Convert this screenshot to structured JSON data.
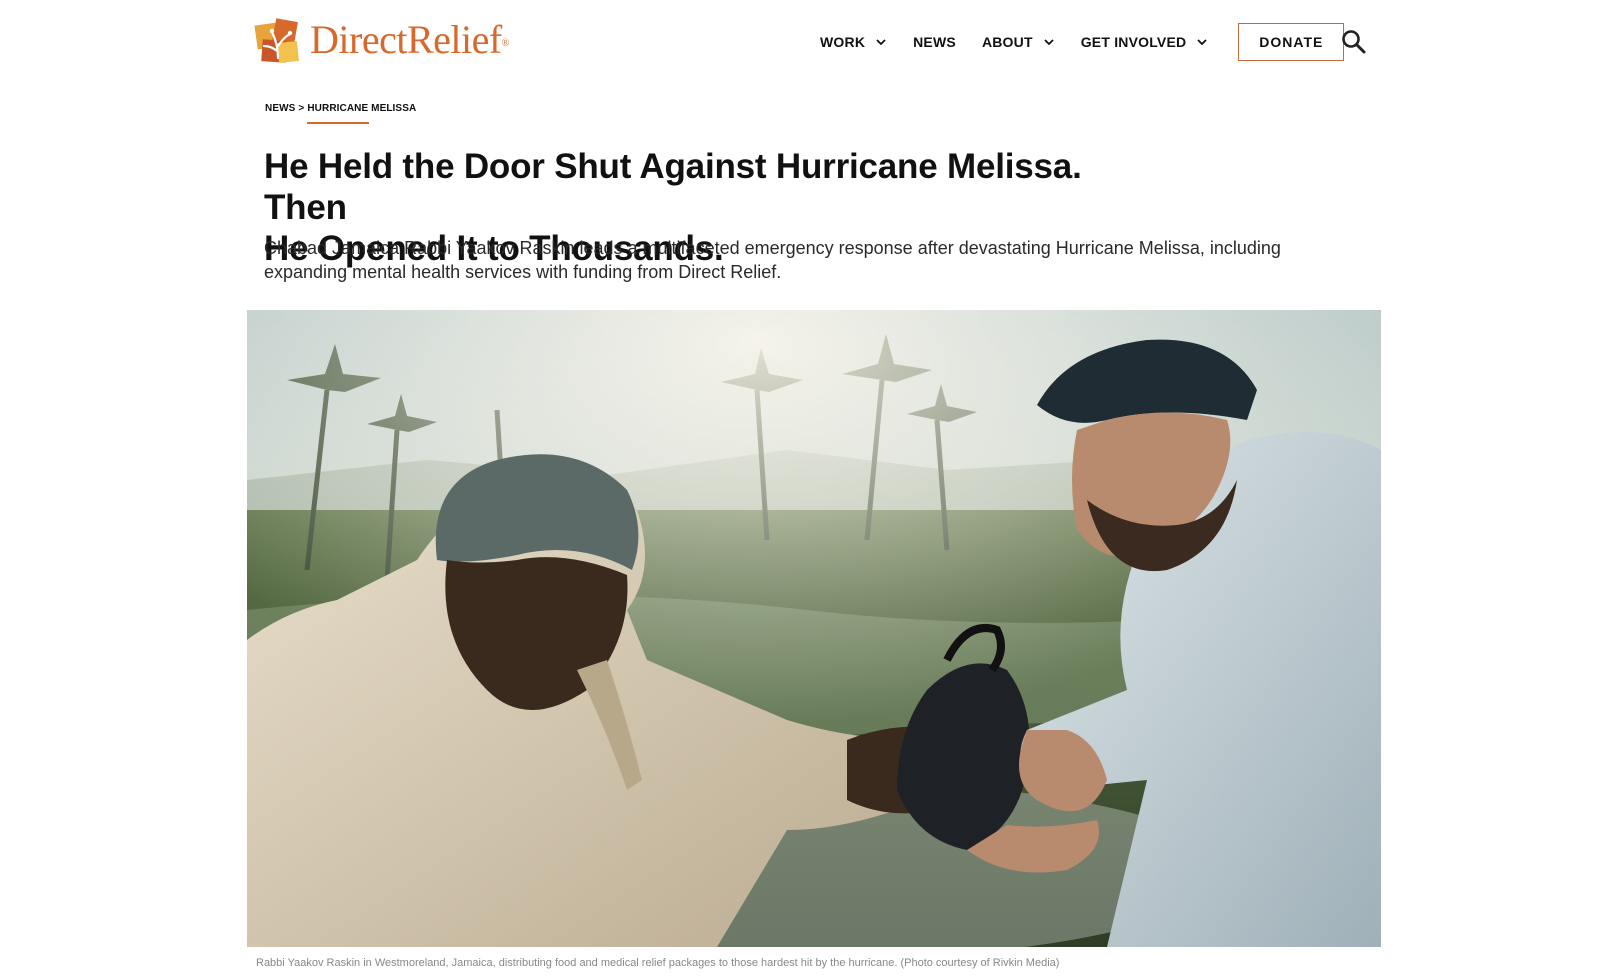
{
  "brand": {
    "name": "DirectRelief",
    "trademark": "®",
    "accent_color": "#d8692c",
    "logo_icon": "direct-relief-logo-icon"
  },
  "nav": {
    "items": [
      {
        "label": "WORK",
        "has_dropdown": true
      },
      {
        "label": "NEWS",
        "has_dropdown": false
      },
      {
        "label": "ABOUT",
        "has_dropdown": true
      },
      {
        "label": "GET INVOLVED",
        "has_dropdown": true
      }
    ],
    "donate_label": "DONATE",
    "donate_border_color": "#c46a3d",
    "search_icon": "search-icon"
  },
  "breadcrumb": {
    "parent": "NEWS",
    "separator": ">",
    "current": "HURRICANE MELISSA"
  },
  "article": {
    "title_line1": "He Held the Door Shut Against Hurricane Melissa. Then",
    "title_line2": "He Opened It to Thousands.",
    "deck": "Chabad Jamaica Rabbi Yaakov Raskin leads a multifaceted emergency response after devastating Hurricane Melissa, including expanding mental health services with funding from Direct Relief.",
    "image_caption": "Rabbi Yaakov Raskin in Westmoreland, Jamaica, distributing food and medical relief packages to those hardest hit by the hurricane. (Photo courtesy of Rivkin Media)"
  }
}
